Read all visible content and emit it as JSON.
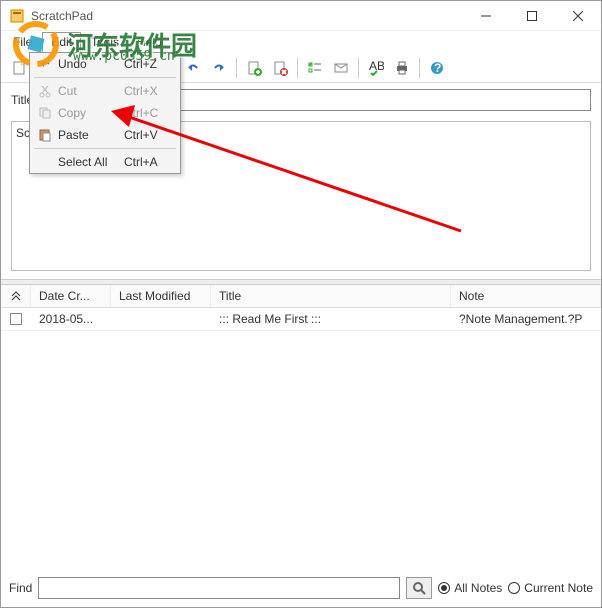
{
  "window": {
    "title": "ScratchPad"
  },
  "menubar": {
    "file": "File",
    "edit": "Edit",
    "tools": "Tools",
    "help": "Help"
  },
  "edit_menu": {
    "undo": {
      "label": "Undo",
      "shortcut": "Ctrl+Z"
    },
    "cut": {
      "label": "Cut",
      "shortcut": "Ctrl+X"
    },
    "copy": {
      "label": "Copy",
      "shortcut": "Ctrl+C"
    },
    "paste": {
      "label": "Paste",
      "shortcut": "Ctrl+V"
    },
    "select_all": {
      "label": "Select All",
      "shortcut": "Ctrl+A"
    }
  },
  "title_row": {
    "label": "Title:",
    "value": ""
  },
  "note_area": {
    "partial": "Scra"
  },
  "columns": {
    "date": "Date Cr...",
    "modified": "Last Modified",
    "title": "Title",
    "note": "Note"
  },
  "rows": [
    {
      "date": "2018-05...",
      "modified": "",
      "title": "::: Read Me First :::",
      "note": "?Note Management.?P"
    }
  ],
  "find": {
    "label": "Find",
    "value": "",
    "all_notes": "All Notes",
    "current_note": "Current Note",
    "selected": "all"
  },
  "watermark": {
    "text": "河东软件园",
    "url": "www.pc0359.cn"
  },
  "icons": {
    "new": "new-file-icon",
    "open": "open-icon",
    "save": "save-icon",
    "cut": "cut-icon",
    "copy": "copy-icon",
    "paste": "paste-icon",
    "undo": "undo-icon",
    "redo": "redo-icon",
    "add": "add-note-icon",
    "delete": "delete-note-icon",
    "mail": "mail-icon",
    "check": "checklist-icon",
    "spell": "spellcheck-icon",
    "print": "print-icon",
    "help": "help-icon"
  }
}
